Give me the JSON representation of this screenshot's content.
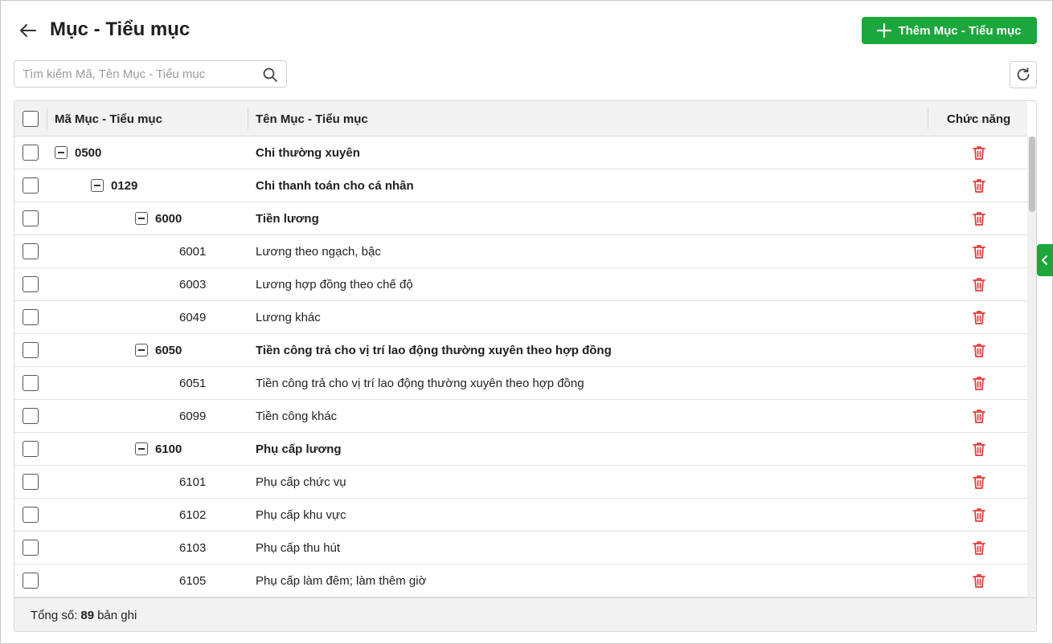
{
  "header": {
    "title": "Mục - Tiểu mục",
    "add_label": "Thêm Mục - Tiểu mục"
  },
  "search": {
    "placeholder": "Tìm kiếm Mã, Tên Mục - Tiểu mục",
    "value": ""
  },
  "table": {
    "columns": {
      "code": "Mã Mục - Tiểu mục",
      "name": "Tên Mục - Tiểu mục",
      "actions": "Chức năng"
    },
    "rows": [
      {
        "code": "0500",
        "name": "Chi thường xuyên",
        "level": 0,
        "group": true
      },
      {
        "code": "0129",
        "name": "Chi thanh toán cho cá nhân",
        "level": 1,
        "group": true
      },
      {
        "code": "6000",
        "name": "Tiền lương",
        "level": 2,
        "group": true
      },
      {
        "code": "6001",
        "name": "Lương theo ngạch, bậc",
        "level": 3,
        "group": false
      },
      {
        "code": "6003",
        "name": "Lương hợp đồng theo chế độ",
        "level": 3,
        "group": false
      },
      {
        "code": "6049",
        "name": "Lương khác",
        "level": 3,
        "group": false
      },
      {
        "code": "6050",
        "name": "Tiền công trả cho vị trí lao động thường xuyên theo hợp đồng",
        "level": 2,
        "group": true
      },
      {
        "code": "6051",
        "name": "Tiền công trả cho vị trí lao động thường xuyên theo hợp đồng",
        "level": 3,
        "group": false
      },
      {
        "code": "6099",
        "name": "Tiền công khác",
        "level": 3,
        "group": false
      },
      {
        "code": "6100",
        "name": "Phụ cấp lương",
        "level": 2,
        "group": true
      },
      {
        "code": "6101",
        "name": "Phụ cấp chức vụ",
        "level": 3,
        "group": false
      },
      {
        "code": "6102",
        "name": "Phụ cấp khu vực",
        "level": 3,
        "group": false
      },
      {
        "code": "6103",
        "name": "Phụ cấp thu hút",
        "level": 3,
        "group": false
      },
      {
        "code": "6105",
        "name": "Phụ cấp làm đêm; làm thêm giờ",
        "level": 3,
        "group": false
      }
    ]
  },
  "footer": {
    "total_prefix": "Tổng số:",
    "total_count": "89",
    "total_suffix": "bản ghi"
  },
  "icons": {
    "back": "arrow-left-icon",
    "add": "plus-icon",
    "search": "search-icon",
    "refresh": "refresh-icon",
    "delete": "trash-icon",
    "collapse": "minus-square-icon",
    "side_panel": "chevron-left-icon"
  },
  "colors": {
    "primary": "#1ba73b",
    "delete": "#e53935"
  }
}
